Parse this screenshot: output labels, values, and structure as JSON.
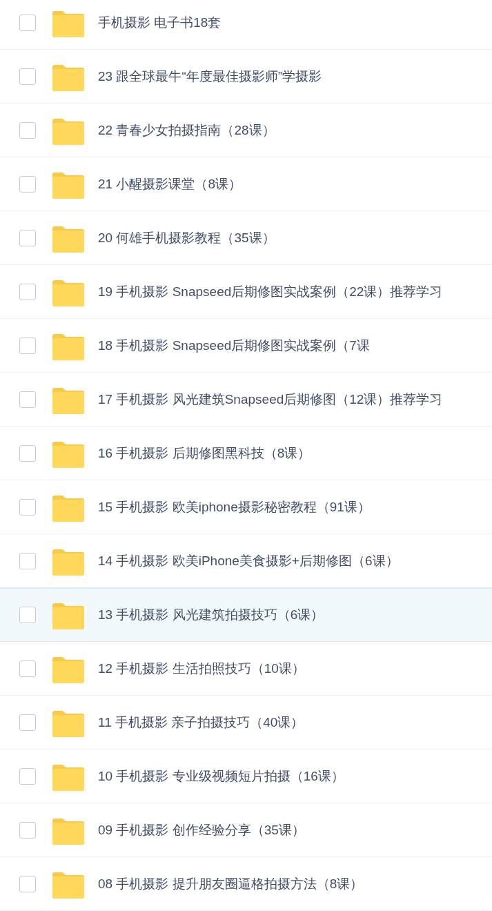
{
  "files": [
    {
      "name": "手机摄影 电子书18套",
      "checked": false,
      "highlighted": false
    },
    {
      "name": "23 跟全球最牛“年度最佳摄影师”学摄影",
      "checked": false,
      "highlighted": false
    },
    {
      "name": "22 青春少女拍摄指南（28课）",
      "checked": false,
      "highlighted": false
    },
    {
      "name": "21 小醒摄影课堂（8课）",
      "checked": false,
      "highlighted": false
    },
    {
      "name": "20 何雄手机摄影教程（35课）",
      "checked": false,
      "highlighted": false
    },
    {
      "name": "19 手机摄影 Snapseed后期修图实战案例（22课）推荐学习",
      "checked": false,
      "highlighted": false
    },
    {
      "name": "18 手机摄影 Snapseed后期修图实战案例（7课",
      "checked": false,
      "highlighted": false
    },
    {
      "name": "17 手机摄影 风光建筑Snapseed后期修图（12课）推荐学习",
      "checked": false,
      "highlighted": false
    },
    {
      "name": "16 手机摄影 后期修图黑科技（8课）",
      "checked": false,
      "highlighted": false
    },
    {
      "name": "15 手机摄影 欧美iphone摄影秘密教程（91课）",
      "checked": false,
      "highlighted": false
    },
    {
      "name": "14 手机摄影 欧美iPhone美食摄影+后期修图（6课）",
      "checked": false,
      "highlighted": false
    },
    {
      "name": "13 手机摄影 风光建筑拍摄技巧（6课）",
      "checked": false,
      "highlighted": true
    },
    {
      "name": "12 手机摄影 生活拍照技巧（10课）",
      "checked": false,
      "highlighted": false
    },
    {
      "name": "11 手机摄影 亲子拍摄技巧（40课）",
      "checked": false,
      "highlighted": false
    },
    {
      "name": "10 手机摄影 专业级视频短片拍摄（16课）",
      "checked": false,
      "highlighted": false
    },
    {
      "name": "09 手机摄影 创作经验分享（35课）",
      "checked": false,
      "highlighted": false
    },
    {
      "name": "08 手机摄影 提升朋友圈逼格拍摄方法（8课）",
      "checked": false,
      "highlighted": false
    }
  ]
}
